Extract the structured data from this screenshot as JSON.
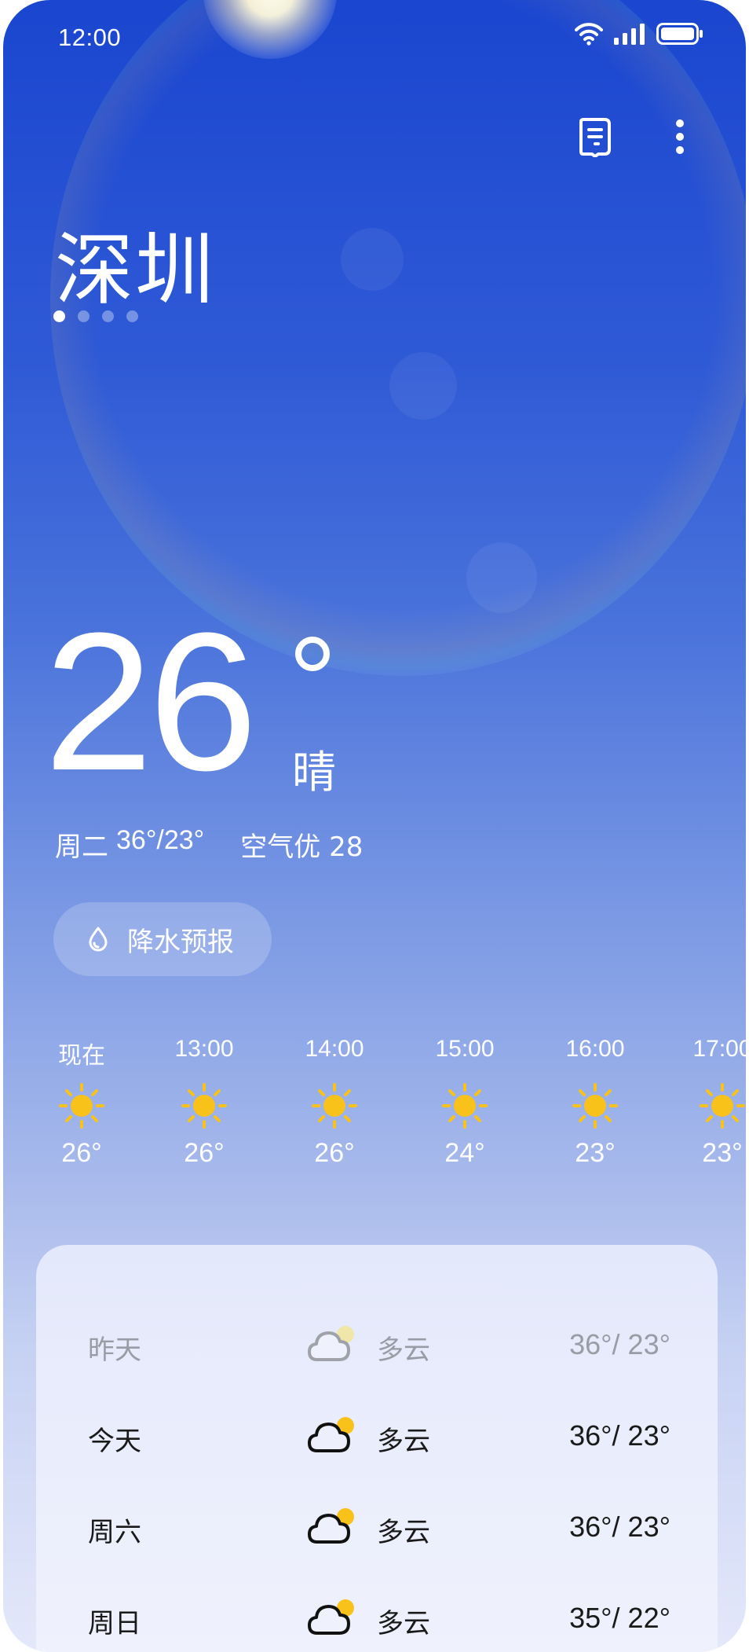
{
  "status_bar": {
    "time": "12:00"
  },
  "header": {
    "city": "深圳"
  },
  "current": {
    "temperature": "26",
    "condition": "晴",
    "day": "周二",
    "high_low": "36°/23°",
    "air_quality": "空气优 28"
  },
  "precip_button": {
    "label": "降水预报"
  },
  "hourly": [
    {
      "time": "现在",
      "temp": "26°",
      "icon": "sun-icon"
    },
    {
      "time": "13:00",
      "temp": "26°",
      "icon": "sun-icon"
    },
    {
      "time": "14:00",
      "temp": "26°",
      "icon": "sun-icon"
    },
    {
      "time": "15:00",
      "temp": "24°",
      "icon": "sun-icon"
    },
    {
      "time": "16:00",
      "temp": "23°",
      "icon": "sun-icon"
    },
    {
      "time": "17:00",
      "temp": "23°",
      "icon": "sun-icon"
    }
  ],
  "daily": [
    {
      "day": "昨天",
      "condition": "多云",
      "temps": "36°/ 23°",
      "icon": "partly-cloudy-icon",
      "past": true
    },
    {
      "day": "今天",
      "condition": "多云",
      "temps": "36°/ 23°",
      "icon": "partly-cloudy-icon",
      "past": false
    },
    {
      "day": "周六",
      "condition": "多云",
      "temps": "36°/ 23°",
      "icon": "partly-cloudy-icon",
      "past": false
    },
    {
      "day": "周日",
      "condition": "多云",
      "temps": "35°/ 22°",
      "icon": "partly-cloudy-icon",
      "past": false
    }
  ],
  "colors": {
    "sun": "#f9c21b",
    "sky_top": "#1a46d0",
    "text_light": "#ffffff",
    "text_dark": "#1a1a1a",
    "text_past": "#9a9ca5"
  },
  "icons": {
    "topbar": [
      "city-list-icon",
      "more-icon"
    ],
    "status": [
      "wifi-icon",
      "signal-icon",
      "battery-icon"
    ],
    "precip": "raindrop-icon"
  },
  "page_indicator": {
    "count": 4,
    "active_index": 0
  }
}
